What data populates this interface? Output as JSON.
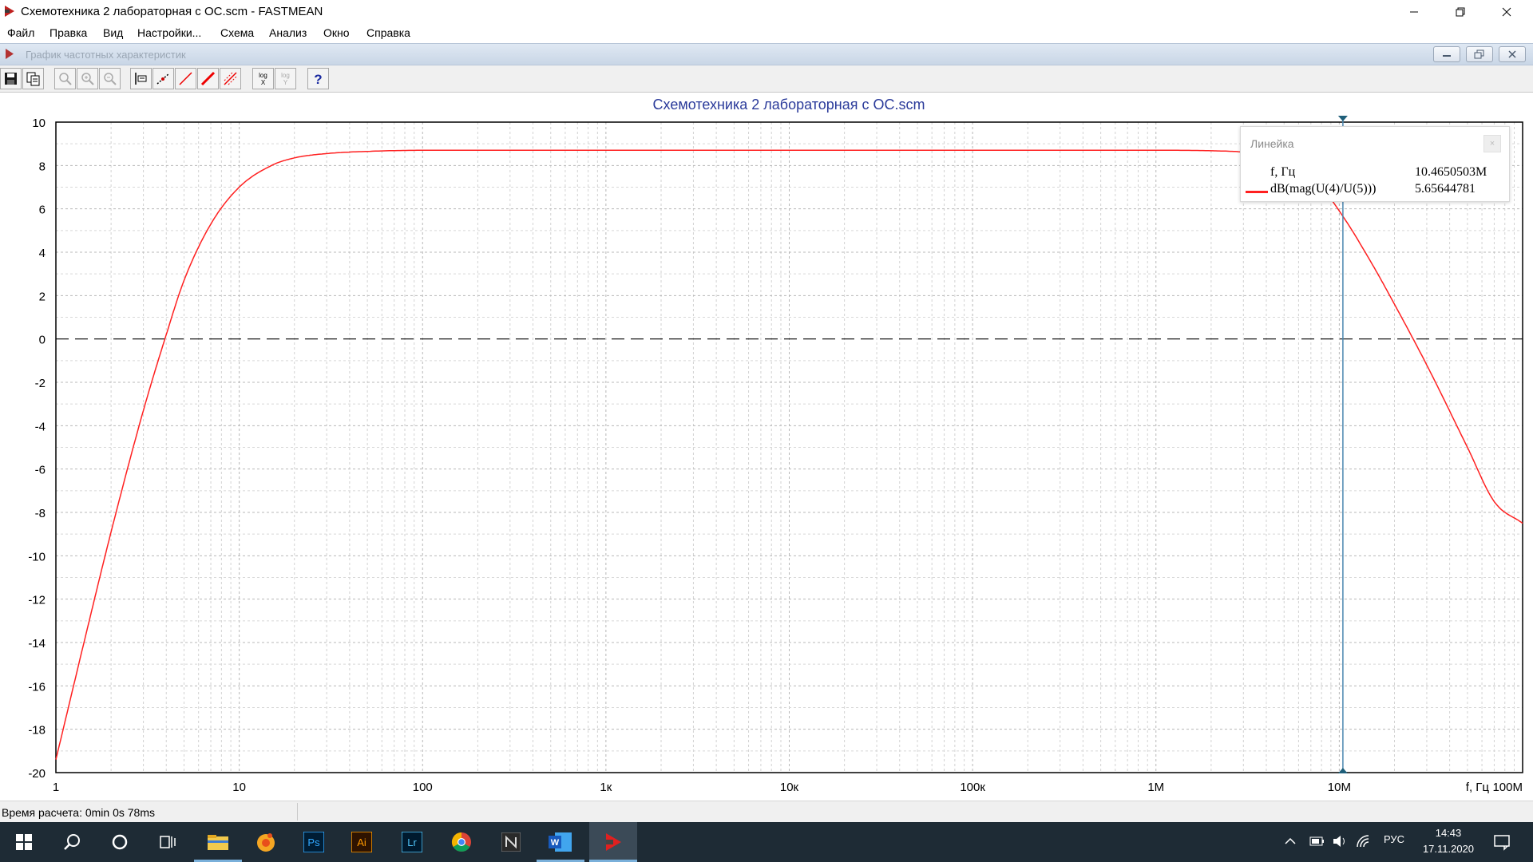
{
  "window": {
    "title": "Схемотехника 2 лабораторная с ОС.scm - FASTMEAN",
    "controls": [
      "minimize",
      "restore",
      "close"
    ]
  },
  "menu": [
    "Файл",
    "Правка",
    "Вид",
    "Настройки...",
    "Схема",
    "Анализ",
    "Окно",
    "Справка"
  ],
  "child_window": {
    "title": "График частотных характеристик"
  },
  "toolbar": {
    "buttons": [
      "save-icon",
      "copy-icon",
      "zoom-icon",
      "zoom-in-icon",
      "zoom-out-icon",
      "ruler-icon",
      "marker-icon",
      "line-icon",
      "thick-line-icon",
      "grid-icon",
      "log-x-icon",
      "log-y-icon",
      "help-icon"
    ],
    "log_x_label": "log",
    "log_x_axis": "X",
    "log_y_label": "log",
    "log_y_axis": "Y",
    "help_label": "?"
  },
  "chart_data": {
    "type": "line",
    "title": "Схемотехника 2 лабораторная с ОС.scm",
    "xscale": "log",
    "xlim": [
      1,
      100000000
    ],
    "ylim": [
      -20,
      10
    ],
    "x_ticks": [
      1,
      10,
      100,
      1000,
      10000,
      100000,
      1000000,
      10000000,
      100000000
    ],
    "x_tick_labels": [
      "1",
      "10",
      "100",
      "1к",
      "10к",
      "100к",
      "1М",
      "10М",
      "100М"
    ],
    "xlabel": "f, Гц",
    "y_ticks": [
      10,
      8,
      6,
      4,
      2,
      0,
      -2,
      -4,
      -6,
      -8,
      -10,
      -12,
      -14,
      -16,
      -18,
      -20
    ],
    "y_tick_labels": [
      "10",
      "8",
      "6",
      "4",
      "2",
      "0",
      "-2",
      "-4",
      "-6",
      "-8",
      "-10",
      "-12",
      "-14",
      "-16",
      "-18",
      "-20"
    ],
    "grid": true,
    "series": [
      {
        "name": "dB(mag(U(4)/U(5)))",
        "color": "#ff2020",
        "x": [
          1,
          1.5,
          2,
          3,
          4,
          5,
          7,
          10,
          15,
          20,
          30,
          50,
          100,
          1000,
          10000,
          100000,
          1000000,
          2000000,
          3000000,
          5000000,
          7000000,
          10465050,
          15000000,
          20000000,
          30000000,
          50000000,
          70000000,
          100000000
        ],
        "y": [
          -19.4,
          -13.2,
          -8.9,
          -3.3,
          0.2,
          2.7,
          5.3,
          7.0,
          8.0,
          8.35,
          8.55,
          8.65,
          8.7,
          8.7,
          8.7,
          8.7,
          8.7,
          8.68,
          8.62,
          8.4,
          7.6,
          5.65644781,
          3.5,
          1.6,
          -1.2,
          -5.0,
          -7.5,
          -8.5
        ]
      }
    ],
    "reference_lines": [
      {
        "y": 0,
        "style": "dashed",
        "color": "#000000"
      }
    ],
    "cursor": {
      "x": 10465050,
      "color": "#4a86b0"
    }
  },
  "ruler": {
    "title": "Линейка",
    "close_label": "×",
    "x_label": "f, Гц",
    "x_value": "10.4650503M",
    "y_label": "dB(mag(U(4)/U(5)))",
    "y_value": "5.65644781"
  },
  "status": {
    "text": "Время расчета: 0min 0s 78ms"
  },
  "taskbar": {
    "apps": [
      "windows-start-icon",
      "search-icon",
      "cortana-icon",
      "task-view-icon",
      "file-explorer-icon",
      "daw-app-icon",
      "photoshop-icon",
      "illustrator-icon",
      "lightroom-icon",
      "chrome-icon",
      "notion-icon",
      "word-icon",
      "fastmean-icon"
    ],
    "ps_label": "Ps",
    "ai_label": "Ai",
    "lr_label": "Lr",
    "w_label": "W",
    "language": "РУС",
    "time": "14:43",
    "date": "17.11.2020"
  }
}
